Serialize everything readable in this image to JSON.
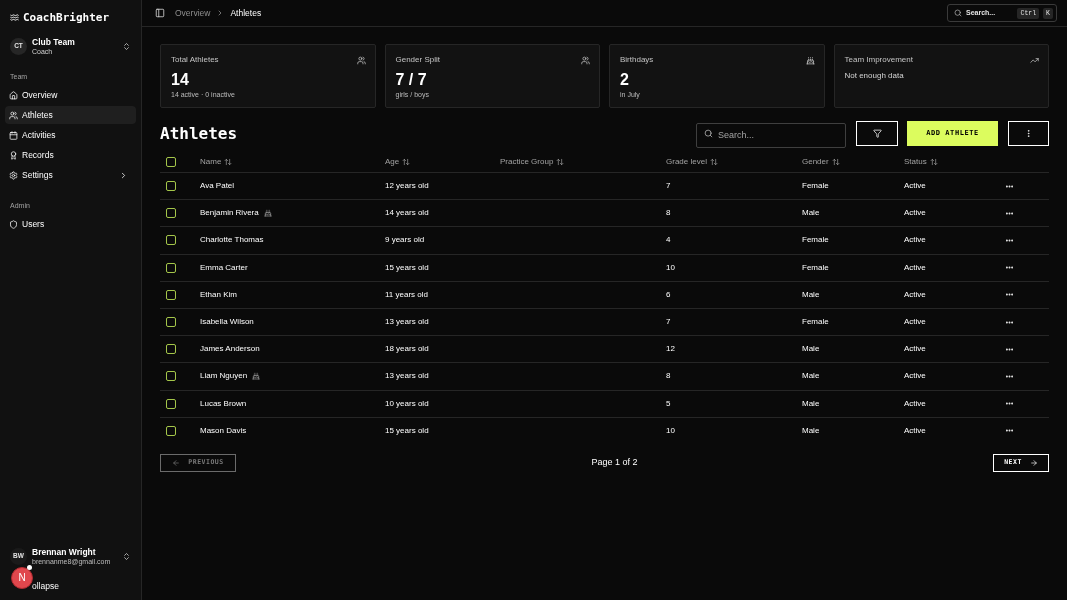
{
  "sidebar": {
    "logo": "CoachBrighter",
    "team_switcher": {
      "initials": "CT",
      "name": "Club Team",
      "role": "Coach"
    },
    "sections": [
      {
        "label": "Team",
        "items": [
          {
            "label": "Overview",
            "kind": "link",
            "selected": false
          },
          {
            "label": "Athletes",
            "kind": "link",
            "selected": true
          },
          {
            "label": "Activities",
            "kind": "link",
            "selected": false
          },
          {
            "label": "Records",
            "kind": "link",
            "selected": false
          },
          {
            "label": "Settings",
            "kind": "group",
            "expanded": false,
            "selected": false
          }
        ]
      },
      {
        "label": "Admin",
        "items": [
          {
            "label": "Users",
            "kind": "link",
            "selected": false
          }
        ]
      }
    ],
    "user": {
      "initials": "BW",
      "name": "Brennan Wright",
      "email": "brennanme8@gmail.com"
    },
    "collapse_label": "ollapse"
  },
  "dev_badge": {
    "letter": "N"
  },
  "breadcrumb": [
    {
      "label": "Overview",
      "current": false
    },
    {
      "label": "Athletes",
      "current": true
    }
  ],
  "search_button": {
    "label": "Search...",
    "keys": [
      "Ctrl",
      "K"
    ]
  },
  "stats": [
    {
      "kind": "metric",
      "title": "Total Athletes",
      "value": "14",
      "sub": "14 active · 0 inactive"
    },
    {
      "kind": "metric",
      "title": "Gender Split",
      "value": "7 / 7",
      "sub": "girls / boys"
    },
    {
      "kind": "metric",
      "title": "Birthdays",
      "value": "2",
      "sub": "in July"
    },
    {
      "kind": "empty",
      "title": "Team Improvement",
      "message": "Not enough data"
    }
  ],
  "page_title": "Athletes",
  "toolbar": {
    "search_placeholder": "Search...",
    "add_label": "ADD ATHLETE"
  },
  "table": {
    "all_checked": false,
    "columns": [
      "Name",
      "Age",
      "Practice Group",
      "Grade level",
      "Gender",
      "Status"
    ],
    "rows": [
      {
        "checked": false,
        "name": "Ava Patel",
        "birthday": false,
        "age": "12 years old",
        "grade_level": "7",
        "gender": "Female",
        "status": "Active"
      },
      {
        "checked": false,
        "name": "Benjamin Rivera",
        "birthday": true,
        "age": "14 years old",
        "grade_level": "8",
        "gender": "Male",
        "status": "Active"
      },
      {
        "checked": false,
        "name": "Charlotte Thomas",
        "birthday": false,
        "age": "9 years old",
        "grade_level": "4",
        "gender": "Female",
        "status": "Active"
      },
      {
        "checked": false,
        "name": "Emma Carter",
        "birthday": false,
        "age": "15 years old",
        "grade_level": "10",
        "gender": "Female",
        "status": "Active"
      },
      {
        "checked": false,
        "name": "Ethan Kim",
        "birthday": false,
        "age": "11 years old",
        "grade_level": "6",
        "gender": "Male",
        "status": "Active"
      },
      {
        "checked": false,
        "name": "Isabella Wilson",
        "birthday": false,
        "age": "13 years old",
        "grade_level": "7",
        "gender": "Female",
        "status": "Active"
      },
      {
        "checked": false,
        "name": "James Anderson",
        "birthday": false,
        "age": "18 years old",
        "grade_level": "12",
        "gender": "Male",
        "status": "Active"
      },
      {
        "checked": false,
        "name": "Liam Nguyen",
        "birthday": true,
        "age": "13 years old",
        "grade_level": "8",
        "gender": "Male",
        "status": "Active"
      },
      {
        "checked": false,
        "name": "Lucas Brown",
        "birthday": false,
        "age": "10 years old",
        "grade_level": "5",
        "gender": "Male",
        "status": "Active"
      },
      {
        "checked": false,
        "name": "Mason Davis",
        "birthday": false,
        "age": "15 years old",
        "grade_level": "10",
        "gender": "Male",
        "status": "Active"
      }
    ]
  },
  "pagination": {
    "previous": {
      "label": "PREVIOUS",
      "disabled": true
    },
    "page_label": "Page 1 of 2",
    "next": {
      "label": "NEXT",
      "disabled": false
    }
  }
}
